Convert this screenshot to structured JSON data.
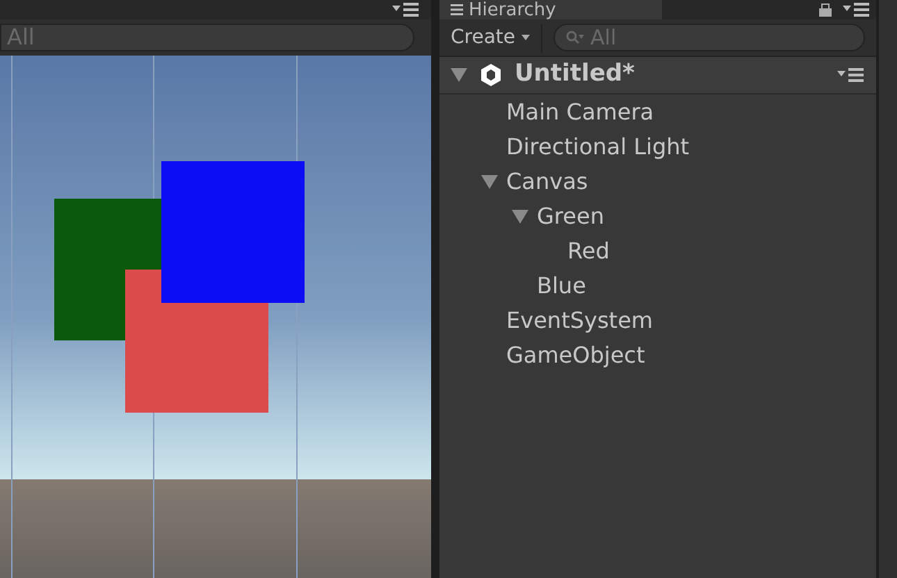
{
  "scene_panel": {
    "search": {
      "placeholder": "All"
    },
    "squares": [
      {
        "color": "#0b5a0b"
      },
      {
        "color": "#db4b4b"
      },
      {
        "color": "#0c0cf5"
      }
    ]
  },
  "hierarchy": {
    "tab": "Hierarchy",
    "create_button": "Create",
    "search": {
      "placeholder": "All"
    },
    "scene": {
      "name": "Untitled*",
      "expanded": true
    },
    "items": [
      {
        "name": "Main Camera"
      },
      {
        "name": "Directional Light"
      },
      {
        "name": "Canvas",
        "expanded": true,
        "children": [
          {
            "name": "Green",
            "expanded": true,
            "children": [
              {
                "name": "Red"
              }
            ]
          },
          {
            "name": "Blue"
          }
        ]
      },
      {
        "name": "EventSystem"
      },
      {
        "name": "GameObject"
      }
    ]
  }
}
